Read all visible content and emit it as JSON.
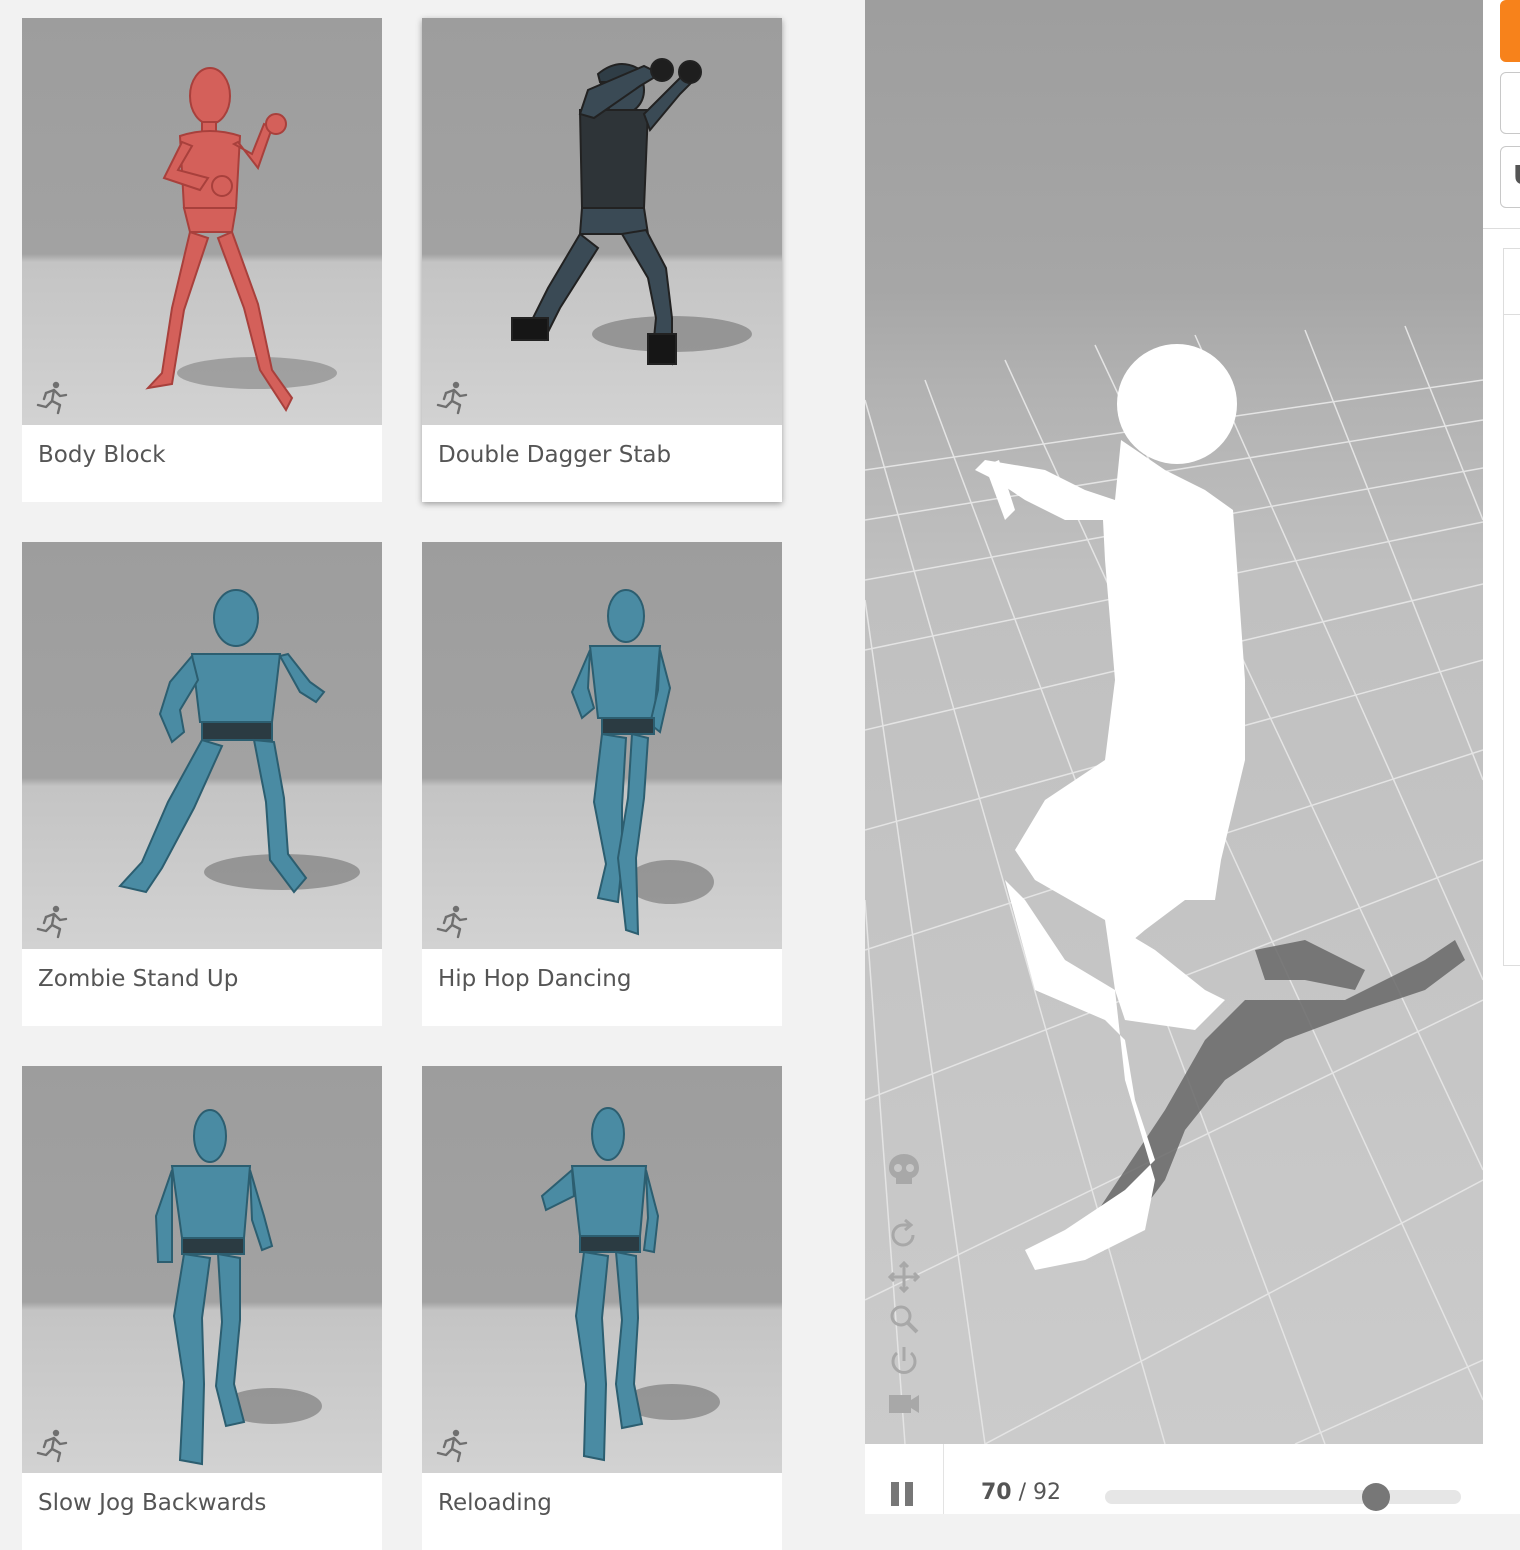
{
  "animations": [
    {
      "label": "Body Block",
      "icon": "running-man-icon",
      "character": "red-mannequin"
    },
    {
      "label": "Double Dagger Stab",
      "icon": "running-man-icon",
      "character": "soldier"
    },
    {
      "label": "Zombie Stand Up",
      "icon": "running-man-icon",
      "character": "blue-robot"
    },
    {
      "label": "Hip Hop Dancing",
      "icon": "running-man-icon",
      "character": "blue-robot"
    },
    {
      "label": "Slow Jog Backwards",
      "icon": "running-man-icon",
      "character": "blue-robot"
    },
    {
      "label": "Reloading",
      "icon": "running-man-icon",
      "character": "blue-robot"
    }
  ],
  "viewer": {
    "tools": [
      "skull-icon",
      "rotate-icon",
      "move-icon",
      "zoom-icon",
      "power-icon",
      "camera-icon"
    ],
    "playback": {
      "state": "playing",
      "current_frame": "70",
      "separator": "/",
      "total_frames": "92",
      "progress": 0.761
    }
  },
  "side_panel": {
    "button_letter": "U"
  },
  "colors": {
    "accent": "#f7821b",
    "red_mannequin": "#d4605a",
    "blue_robot": "#4a8ba3",
    "soldier": "#3a4a55",
    "viewer_floor": "#c8c8c8",
    "viewer_sky": "#a0a0a0"
  }
}
